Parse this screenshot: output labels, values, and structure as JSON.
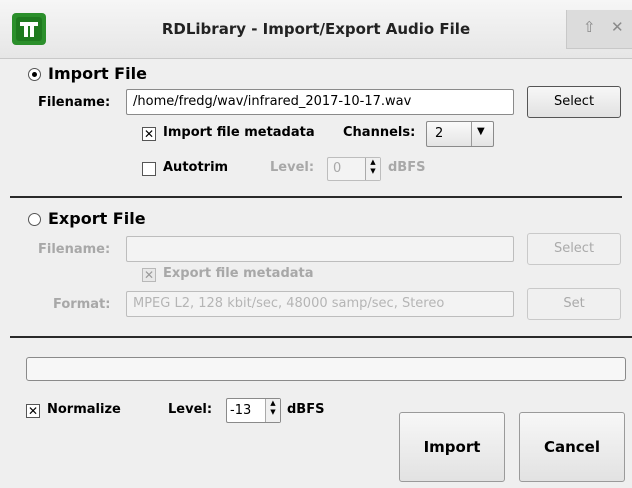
{
  "window": {
    "title": "RDLibrary - Import/Export Audio File",
    "icon": "rivendell-icon",
    "controls": [
      "restore-icon",
      "close-icon"
    ]
  },
  "import": {
    "heading": "Import File",
    "filename_label": "Filename:",
    "filename_value": "/home/fredg/wav/infrared_2017-10-17.wav",
    "select_label": "Select",
    "metadata_label": "Import file metadata",
    "metadata_checked": true,
    "channels_label": "Channels:",
    "channels_value": "2",
    "autotrim_label": "Autotrim",
    "autotrim_checked": false,
    "level_label": "Level:",
    "level_value": "0",
    "level_unit": "dBFS"
  },
  "export": {
    "heading": "Export File",
    "filename_label": "Filename:",
    "filename_value": "",
    "select_label": "Select",
    "metadata_label": "Export file metadata",
    "format_label": "Format:",
    "format_value": "MPEG L2, 128 kbit/sec, 48000 samp/sec, Stereo",
    "set_label": "Set"
  },
  "progress": {
    "value": 0
  },
  "normalize": {
    "label": "Normalize",
    "checked": true,
    "level_label": "Level:",
    "level_value": "-13",
    "level_unit": "dBFS"
  },
  "buttons": {
    "import_label": "Import",
    "cancel_label": "Cancel"
  }
}
